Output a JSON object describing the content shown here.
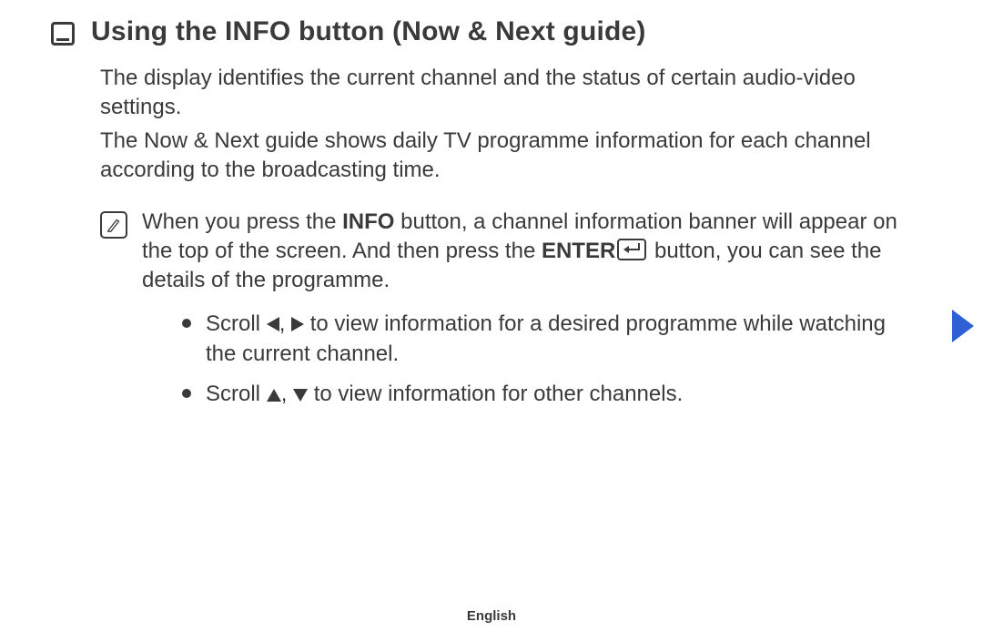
{
  "title": "Using the INFO button (Now & Next guide)",
  "paragraphs": {
    "p1": "The display identifies the current channel and the status of certain audio-video settings.",
    "p2": "The Now & Next guide shows daily TV programme information for each channel according to the broadcasting time."
  },
  "note": {
    "pre": "When you press the ",
    "info": "INFO",
    "mid1": " button, a channel information banner will appear on the top of the screen. And then press the ",
    "enter": "ENTER",
    "mid2": " button, you can see the details of the programme."
  },
  "bullets": {
    "b1": {
      "pre": "Scroll ",
      "sep": ", ",
      "post": " to view information for a desired programme while watching the current channel."
    },
    "b2": {
      "pre": "Scroll ",
      "sep": ", ",
      "post": " to view information for other channels."
    }
  },
  "footer": {
    "language": "English"
  }
}
